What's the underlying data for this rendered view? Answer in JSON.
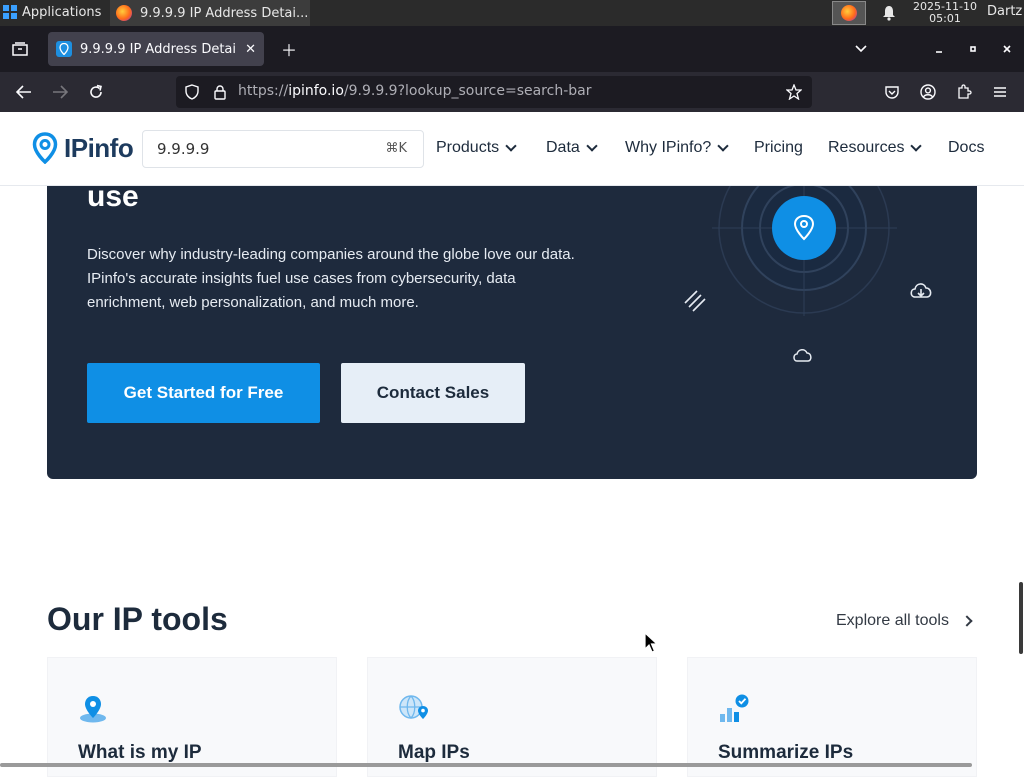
{
  "taskbar": {
    "applications_label": "Applications",
    "task_title": "9.9.9.9 IP Address Detai...",
    "clock_date": "2025-11-10",
    "clock_time": "05:01",
    "user": "Dartz"
  },
  "browser": {
    "tab_title": "9.9.9.9 IP Address Detail",
    "url_prefix": "https://",
    "url_host": "ipinfo.io",
    "url_path": "/9.9.9.9?lookup_source=search-bar"
  },
  "site": {
    "logo_text": "IPinfo",
    "search_value": "9.9.9.9",
    "search_shortcut": "⌘K",
    "nav": [
      {
        "label": "Products"
      },
      {
        "label": "Data"
      },
      {
        "label": "Why IPinfo?"
      },
      {
        "label": "Pricing"
      },
      {
        "label": "Resources"
      },
      {
        "label": "Docs"
      }
    ]
  },
  "hero": {
    "heading_tail": "use",
    "description": "Discover why industry-leading companies around the globe love our data. IPinfo's accurate insights fuel use cases from cybersecurity, data enrichment, web personalization, and much more.",
    "primary_cta": "Get Started for Free",
    "secondary_cta": "Contact Sales"
  },
  "tools": {
    "title": "Our IP tools",
    "explore_label": "Explore all tools",
    "cards": [
      {
        "title": "What is my IP",
        "icon": "location-pin-icon"
      },
      {
        "title": "Map IPs",
        "icon": "globe-pin-icon"
      },
      {
        "title": "Summarize IPs",
        "icon": "bar-chart-check-icon"
      }
    ]
  },
  "colors": {
    "accent": "#0f8fe5",
    "hero_bg": "#1e2a3d",
    "text_dark": "#1d2b3c"
  }
}
